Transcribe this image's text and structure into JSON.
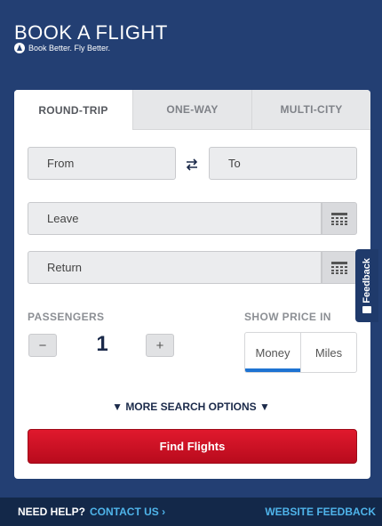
{
  "header": {
    "title": "BOOK A FLIGHT",
    "tagline": "Book Better. Fly Better."
  },
  "tabs": [
    {
      "label": "ROUND-TRIP",
      "active": true
    },
    {
      "label": "ONE-WAY",
      "active": false
    },
    {
      "label": "MULTI-CITY",
      "active": false
    }
  ],
  "form": {
    "from_placeholder": "From",
    "to_placeholder": "To",
    "leave_placeholder": "Leave",
    "return_placeholder": "Return",
    "passengers_label": "PASSENGERS",
    "passengers_count": "1",
    "decrement": "−",
    "increment": "+",
    "show_price_label": "SHOW PRICE IN",
    "price_options": [
      "Money",
      "Miles"
    ],
    "price_selected": "Money",
    "more_options": "MORE SEARCH OPTIONS",
    "find_button": "Find Flights"
  },
  "feedback_tab": "Feedback",
  "footer": {
    "need_help": "NEED HELP?",
    "contact": "CONTACT US",
    "website_feedback": "WEBSITE FEEDBACK"
  },
  "colors": {
    "background": "#233f73",
    "footer": "#132849",
    "accent": "#1e73d2",
    "cta": "#d0112a",
    "link": "#4fb4ea"
  }
}
